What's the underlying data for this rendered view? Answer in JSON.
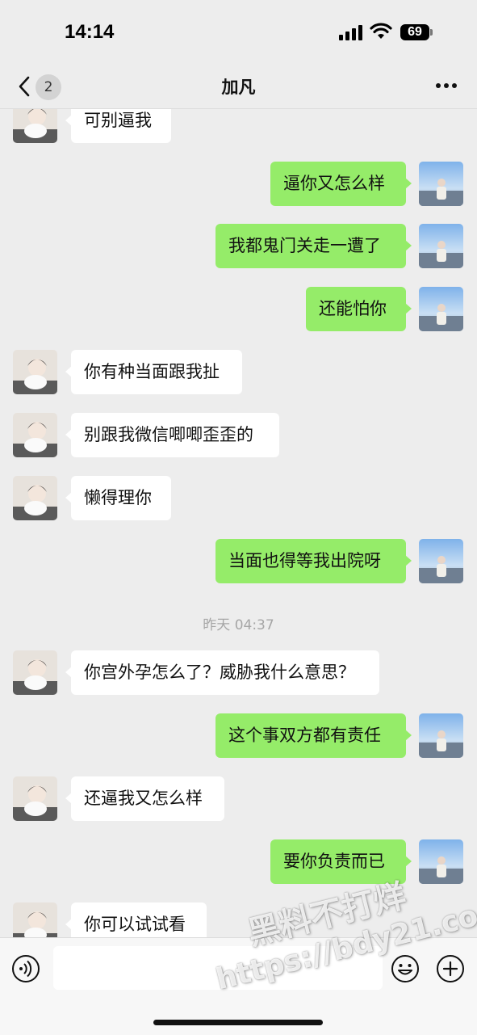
{
  "status_bar": {
    "time": "14:14",
    "battery": "69"
  },
  "nav": {
    "back_count": "2",
    "title": "加凡"
  },
  "messages": [
    {
      "side": "in",
      "text": "可别逼我"
    },
    {
      "side": "out",
      "text": "逼你又怎么样"
    },
    {
      "side": "out",
      "text": "我都鬼门关走一遭了"
    },
    {
      "side": "out",
      "text": "还能怕你"
    },
    {
      "side": "in",
      "text": "你有种当面跟我扯"
    },
    {
      "side": "in",
      "text": "别跟我微信唧唧歪歪的"
    },
    {
      "side": "in",
      "text": "懒得理你"
    },
    {
      "side": "out",
      "text": "当面也得等我出院呀"
    },
    {
      "side": "in",
      "text": "你宫外孕怎么了？威胁我什么意思？"
    },
    {
      "side": "out",
      "text": "这个事双方都有责任"
    },
    {
      "side": "in",
      "text": "还逼我又怎么样"
    },
    {
      "side": "out",
      "text": "要你负责而已"
    },
    {
      "side": "in",
      "text": "你可以试试看"
    }
  ],
  "timestamp": "昨天 04:37",
  "input": {
    "value": "",
    "voice_icon": "voice-icon",
    "emoji_icon": "emoji-icon",
    "plus_icon": "plus-icon"
  },
  "watermark": {
    "line1": "黑料不打烊",
    "line2": "https://bdy21.co"
  },
  "colors": {
    "background": "#ededed",
    "outgoing_bubble": "#95ec69",
    "incoming_bubble": "#ffffff",
    "timestamp": "#a6a6a6"
  }
}
